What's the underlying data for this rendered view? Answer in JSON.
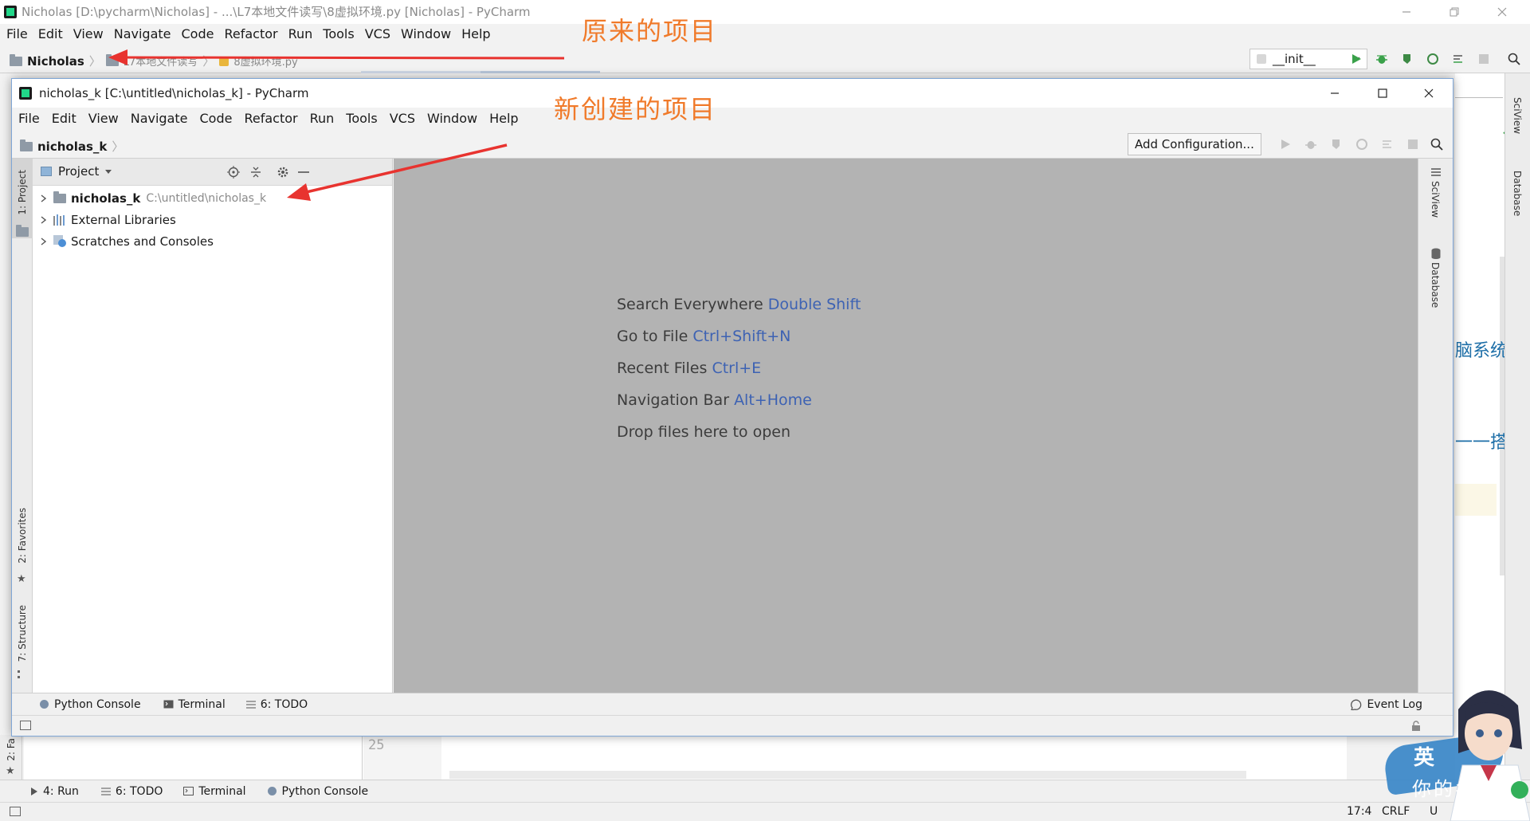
{
  "back_window": {
    "title": "Nicholas [D:\\pycharm\\Nicholas] - ...\\L7本地文件读写\\8虚拟环境.py [Nicholas] - PyCharm",
    "menu": [
      "File",
      "Edit",
      "View",
      "Navigate",
      "Code",
      "Refactor",
      "Run",
      "Tools",
      "VCS",
      "Window",
      "Help"
    ],
    "breadcrumb": [
      "Nicholas",
      "L7本地文件读写",
      "8虚拟环境.py"
    ],
    "run_config": "__init__",
    "gutter_line": "25",
    "right_tools": [
      "SciView",
      "Database"
    ],
    "bottom_tabs": [
      {
        "label": "4: Run"
      },
      {
        "label": "6: TODO"
      },
      {
        "label": "Terminal"
      },
      {
        "label": "Python Console"
      }
    ],
    "left_tabs": [
      "2: Fa"
    ],
    "status": {
      "position": "17:4",
      "line_sep": "CRLF",
      "encoding": "U"
    },
    "side_text_1": "脑系统",
    "side_text_2": "一一搭"
  },
  "front_window": {
    "title": "nicholas_k [C:\\untitled\\nicholas_k] - PyCharm",
    "menu": [
      "File",
      "Edit",
      "View",
      "Navigate",
      "Code",
      "Refactor",
      "Run",
      "Tools",
      "VCS",
      "Window",
      "Help"
    ],
    "breadcrumb": "nicholas_k",
    "add_configuration": "Add Configuration...",
    "project_panel": {
      "header": "Project",
      "tree": [
        {
          "name": "nicholas_k",
          "path": "C:\\untitled\\nicholas_k",
          "icon": "folder-icon"
        },
        {
          "name": "External Libraries",
          "path": "",
          "icon": "libraries-icon"
        },
        {
          "name": "Scratches and Consoles",
          "path": "",
          "icon": "scratches-icon"
        }
      ]
    },
    "left_tabs": [
      "1: Project",
      "2: Favorites",
      "7: Structure"
    ],
    "right_tabs": [
      "SciView",
      "Database"
    ],
    "editor_hints": [
      {
        "text": "Search Everywhere",
        "key": "Double Shift"
      },
      {
        "text": "Go to File",
        "key": "Ctrl+Shift+N"
      },
      {
        "text": "Recent Files",
        "key": "Ctrl+E"
      },
      {
        "text": "Navigation Bar",
        "key": "Alt+Home"
      },
      {
        "text": "Drop files here to open",
        "key": ""
      }
    ],
    "bottom_tabs": [
      {
        "label": "Python Console"
      },
      {
        "label": "Terminal"
      },
      {
        "label": "6: TODO"
      }
    ],
    "event_log": "Event Log"
  },
  "annotations": {
    "original_project": "原来的项目",
    "new_project": "新创建的项目"
  },
  "mascot": {
    "text1": "英",
    "text2": "你的名字"
  },
  "colors": {
    "annotation": "#f07a2a",
    "arrow": "#e8332f",
    "run_green": "#3aa14a",
    "hint_key": "#3d62b3"
  }
}
